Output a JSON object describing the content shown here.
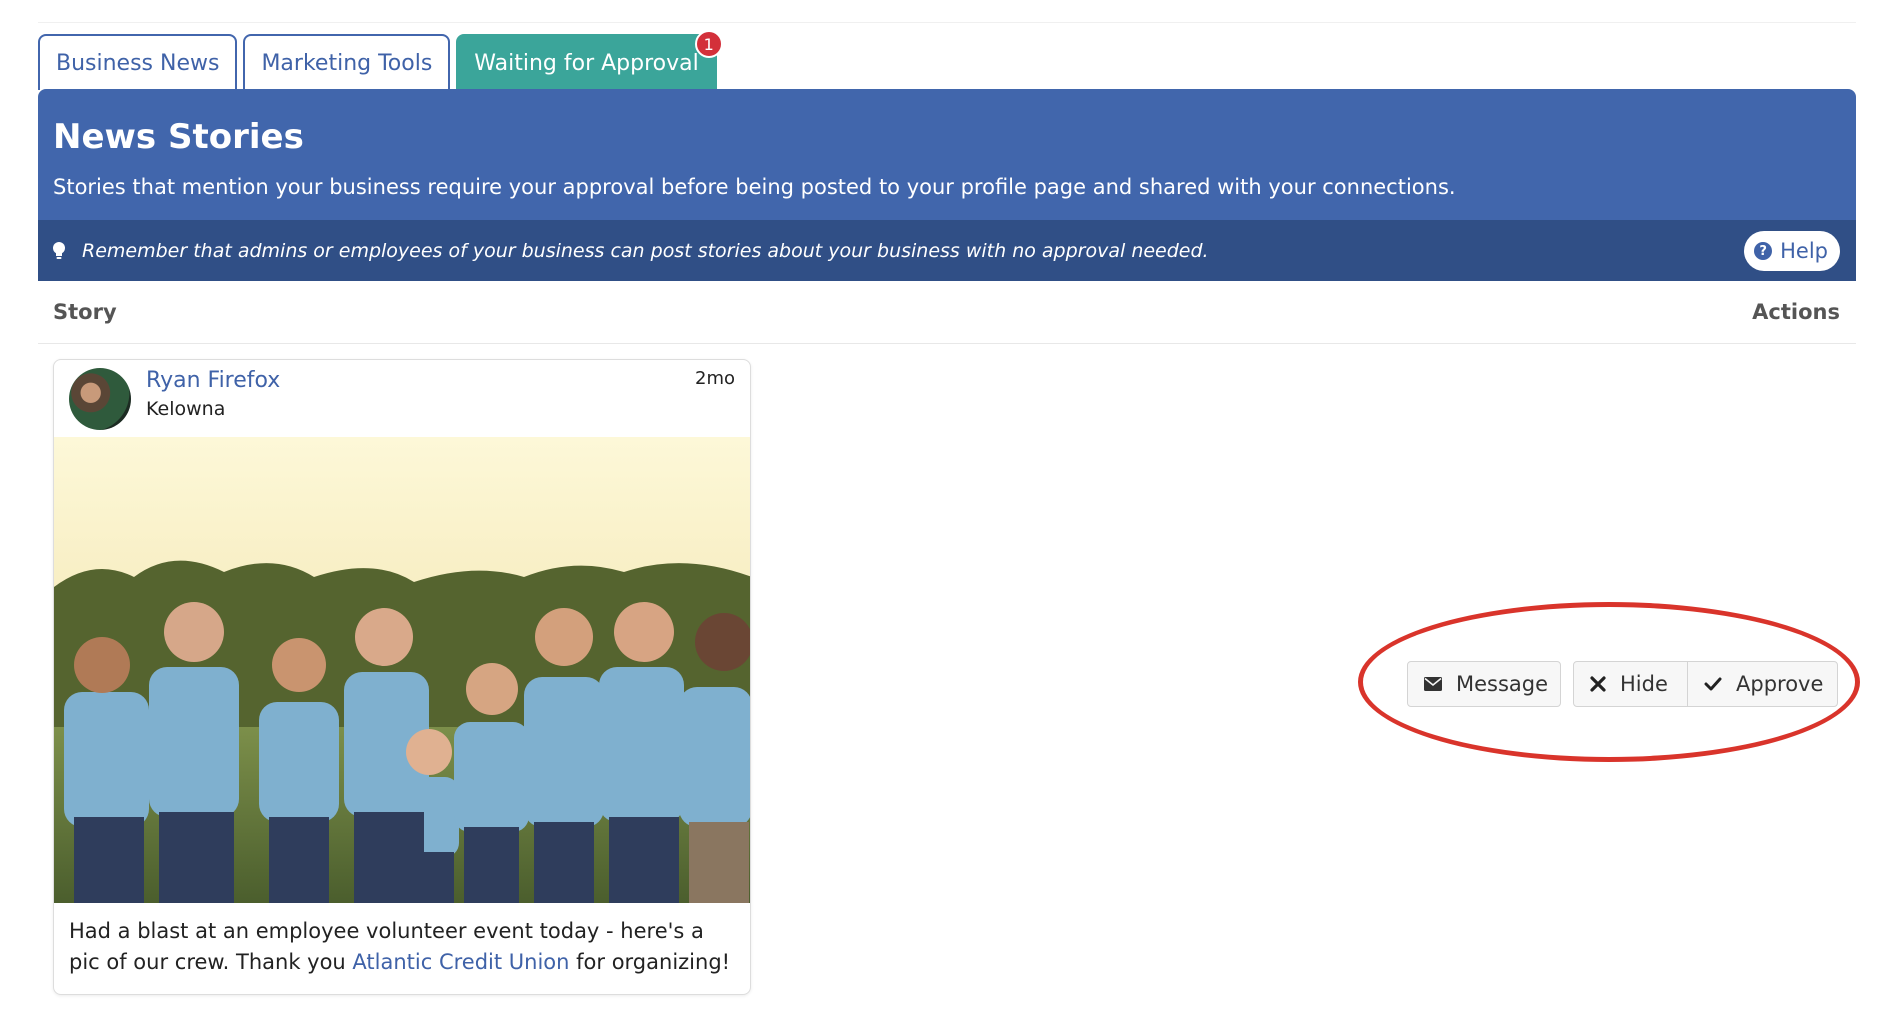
{
  "tabs": [
    {
      "label": "Business News",
      "active": false
    },
    {
      "label": "Marketing Tools",
      "active": false
    },
    {
      "label": "Waiting for Approval",
      "active": true,
      "badge": "1"
    }
  ],
  "header": {
    "title": "News Stories",
    "description": "Stories that mention your business require your approval before being posted to your profile page and shared with your connections.",
    "tip": "Remember that admins or employees of your business can post stories about your business with no approval needed.",
    "help_label": "Help"
  },
  "table": {
    "col_story": "Story",
    "col_actions": "Actions"
  },
  "story": {
    "author": "Ryan Firefox",
    "location": "Kelowna",
    "time": "2mo",
    "caption_before": "Had a blast at an employee volunteer event today - here's a pic of our crew. Thank you ",
    "caption_link": "Atlantic Credit Union",
    "caption_after": " for organizing!"
  },
  "actions": {
    "message_label": "Message",
    "hide_label": "Hide",
    "approve_label": "Approve"
  },
  "colors": {
    "brand_blue": "#4166ac",
    "tip_bar": "#304f86",
    "tab_active": "#3ba59a",
    "badge": "#d3303a",
    "highlight": "#d9342b"
  }
}
